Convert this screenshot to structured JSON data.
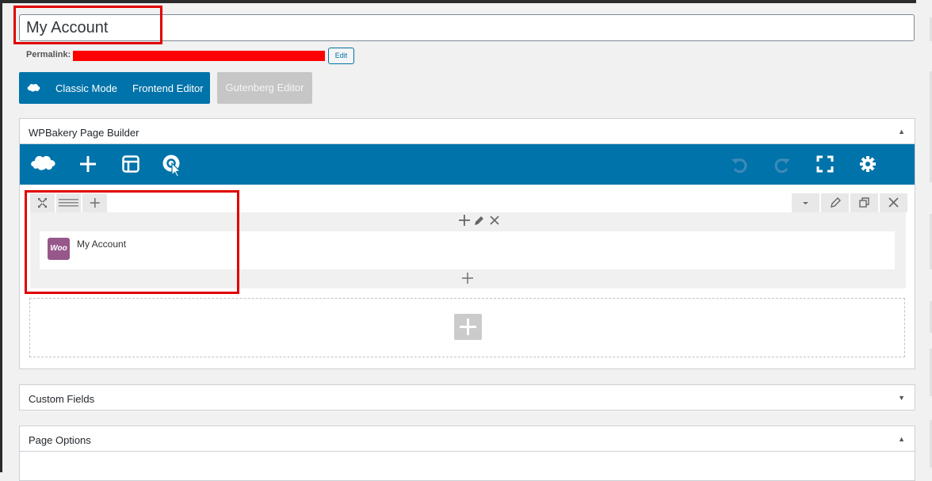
{
  "post": {
    "title": "My Account",
    "permalink_label": "Permalink:",
    "edit_label": "Edit"
  },
  "editor_modes": {
    "classic": "Classic Mode",
    "frontend": "Frontend Editor",
    "gutenberg": "Gutenberg Editor"
  },
  "wpbakery": {
    "title": "WPBakery Page Builder",
    "element": {
      "title": "My Account",
      "logo_text": "Woo"
    }
  },
  "panels": {
    "custom_fields": "Custom Fields",
    "page_options": "Page Options"
  },
  "colors": {
    "accent": "#0073aa",
    "highlight": "#e00000",
    "woo": "#96588a"
  }
}
